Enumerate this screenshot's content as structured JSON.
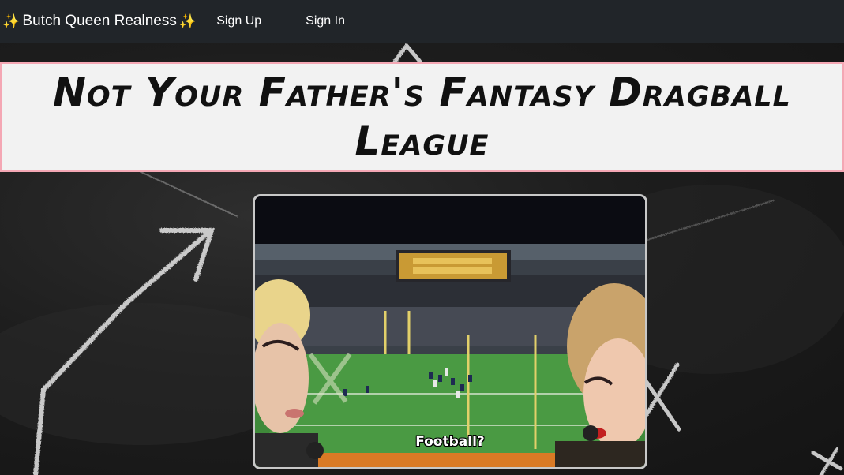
{
  "navbar": {
    "brand_sparkle_left": "✨",
    "brand_label": "Butch Queen Realness",
    "brand_sparkle_right": "✨",
    "links": [
      {
        "label": "Sign Up"
      },
      {
        "label": "Sign In"
      }
    ]
  },
  "banner": {
    "title": "Not Your Father's Fantasy Dragball League",
    "border_color": "#f4a7b4"
  },
  "media": {
    "caption": "Football?",
    "icons": [
      "stadium-scene",
      "queen-left",
      "queen-right"
    ]
  },
  "colors": {
    "navbar_bg": "#212529",
    "chalkboard_bg": "#1d1d1d",
    "banner_bg": "#f2f2f2"
  }
}
